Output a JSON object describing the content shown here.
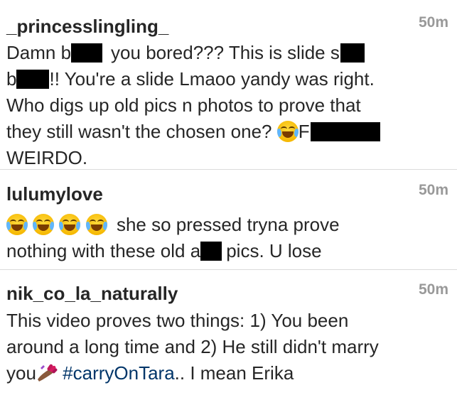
{
  "comments": [
    {
      "username": "_princesslingling_",
      "time": "50m",
      "lines": [
        [
          "Damn b",
          "you bored??? This is slide s"
        ],
        [
          "b",
          "!! You're a slide Lmaoo yandy was right."
        ],
        [
          "Who digs up old pics n photos to prove that"
        ],
        [
          "they still wasn't the chosen one?",
          "F"
        ],
        [
          "WEIRDO."
        ]
      ]
    },
    {
      "username": "lulumylove",
      "time": "50m",
      "lines": [
        [
          "she so pressed tryna prove"
        ],
        [
          "nothing with these old a",
          "pics. U lose"
        ]
      ]
    },
    {
      "username": "nik_co_la_naturally",
      "time": "50m",
      "lines": [
        [
          "This video proves two things: 1) You been"
        ],
        [
          "around  a long time and 2) He still didn't marry"
        ],
        [
          "you",
          "#carryOnTara",
          ".. I mean Erika"
        ]
      ]
    }
  ],
  "icons": {
    "laugh_emoji": "face-with-tears-of-joy-icon",
    "nail_emoji": "nail-polish-icon"
  },
  "colors": {
    "text": "#262626",
    "timestamp": "#999999",
    "hashtag": "#003569",
    "divider": "#dbdbdb",
    "censor": "#000000"
  }
}
